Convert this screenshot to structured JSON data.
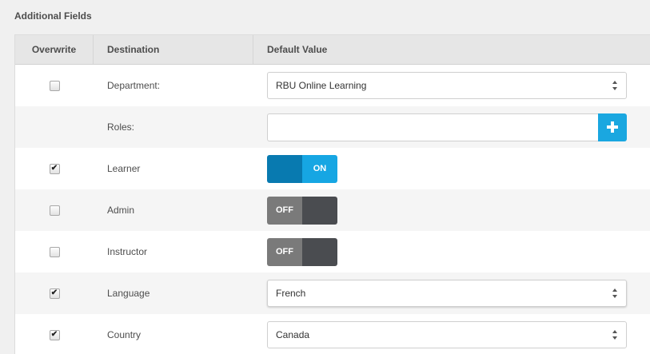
{
  "section": {
    "title": "Additional Fields"
  },
  "table": {
    "headers": {
      "overwrite": "Overwrite",
      "destination": "Destination",
      "default_value": "Default Value"
    },
    "rows": [
      {
        "destination": "Department:",
        "overwrite_checked": false,
        "control": "select",
        "value": "RBU Online Learning"
      },
      {
        "destination": "Roles:",
        "control": "tag-input",
        "value": ""
      },
      {
        "destination": "Learner",
        "overwrite_checked": true,
        "control": "toggle",
        "state": "ON"
      },
      {
        "destination": "Admin",
        "overwrite_checked": false,
        "control": "toggle",
        "state": "OFF"
      },
      {
        "destination": "Instructor",
        "overwrite_checked": false,
        "control": "toggle",
        "state": "OFF"
      },
      {
        "destination": "Language",
        "overwrite_checked": true,
        "control": "select",
        "value": "French"
      },
      {
        "destination": "Country",
        "overwrite_checked": true,
        "control": "select",
        "value": "Canada"
      }
    ]
  },
  "icons": {
    "add": "plus-icon",
    "select": "sort-icon",
    "check": "checkmark"
  },
  "check_glyph": "✔",
  "colors": {
    "toggle_on": "#16a6e3",
    "toggle_on_knob": "#087ab0",
    "toggle_off": "#7a7a7a",
    "toggle_off_knob": "#4a4c50",
    "add_button": "#1aa7e0"
  }
}
